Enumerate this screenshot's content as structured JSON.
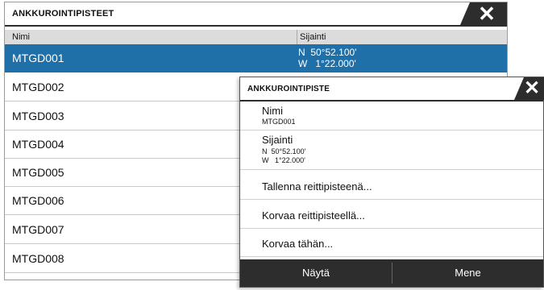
{
  "list_window": {
    "title": "ANKKUROINTIPISTEET",
    "close_glyph": "✕",
    "columns": {
      "name": "Nimi",
      "position": "Sijainti"
    },
    "rows": [
      {
        "name": "MTGD001",
        "lat": "N  50°52.100'",
        "lon": "W   1°22.000'"
      },
      {
        "name": "MTGD002"
      },
      {
        "name": "MTGD003"
      },
      {
        "name": "MTGD004"
      },
      {
        "name": "MTGD005"
      },
      {
        "name": "MTGD006"
      },
      {
        "name": "MTGD007"
      },
      {
        "name": "MTGD008"
      }
    ]
  },
  "detail_dialog": {
    "title": "ANKKUROINTIPISTE",
    "close_glyph": "✕",
    "name_label": "Nimi",
    "name_value": "MTGD001",
    "position_label": "Sijainti",
    "lat": "N  50°52.100'",
    "lon": "W   1°22.000'",
    "actions": {
      "save_as_waypoint": "Tallenna reittipisteenä...",
      "replace_with_waypoint": "Korvaa reittipisteellä...",
      "replace_here": "Korvaa tähän..."
    },
    "buttons": {
      "show": "Näytä",
      "go": "Mene"
    }
  },
  "colors": {
    "selection": "#1f6fa8",
    "titlebar_dark": "#2d2d2d",
    "header_bg": "#dcdcdc"
  }
}
